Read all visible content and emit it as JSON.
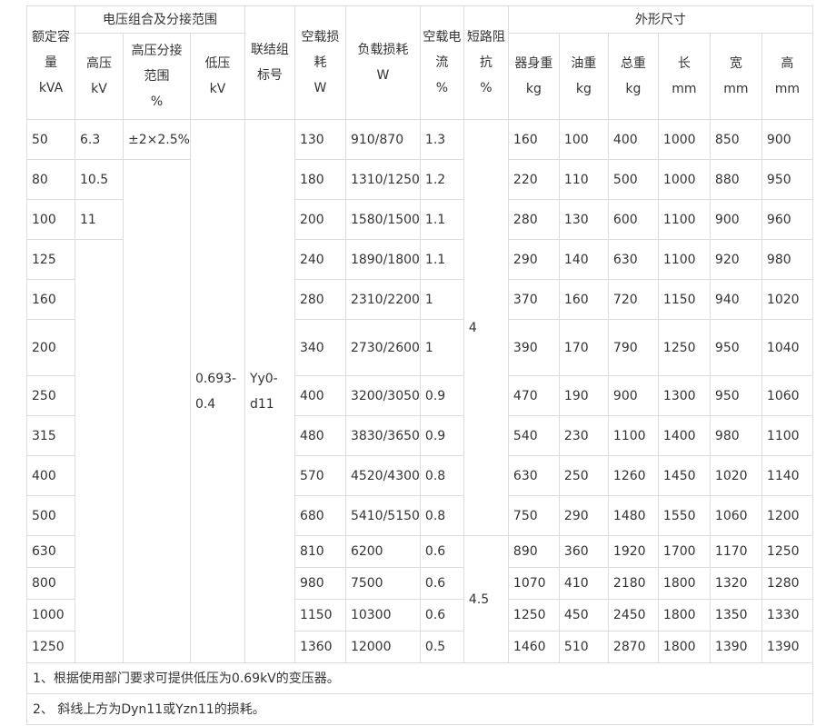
{
  "headers": {
    "capacity": [
      "额定容",
      "量",
      "kVA"
    ],
    "voltage_group": "电压组合及分接范围",
    "hv": [
      "高压",
      "kV"
    ],
    "tap": [
      "高压分接",
      "范围",
      "%"
    ],
    "lv": [
      "低压",
      "kV"
    ],
    "vector": [
      "联结组",
      "标号"
    ],
    "noload_loss": [
      "空载损",
      "耗",
      "W"
    ],
    "load_loss": [
      "负载损耗",
      "W"
    ],
    "noload_current": [
      "空载电",
      "流",
      "%"
    ],
    "impedance": [
      "短路阻",
      "抗",
      "%"
    ],
    "dimensions": "外形尺寸",
    "body_weight": [
      "器身重",
      "kg"
    ],
    "oil_weight": [
      "油重",
      "kg"
    ],
    "total_weight": [
      "总重",
      "kg"
    ],
    "length": [
      "长",
      "mm"
    ],
    "width": [
      "宽",
      "mm"
    ],
    "height": [
      "高",
      "mm"
    ]
  },
  "merged": {
    "hv": [
      "6.3",
      "10.5",
      "11"
    ],
    "tap": "±2×2.5%",
    "lv": [
      "0.693-",
      "0.4"
    ],
    "vector": [
      "Yy0-",
      "d11"
    ],
    "impedance_a": "4",
    "impedance_b": "4.5"
  },
  "rows": [
    {
      "cap": "50",
      "p0": "130",
      "pk": "910/870",
      "i0": "1.3",
      "body": "160",
      "oil": "100",
      "total": "400",
      "len": "1000",
      "wid": "850",
      "hgt": "900"
    },
    {
      "cap": "80",
      "p0": "180",
      "pk": "1310/1250",
      "i0": "1.2",
      "body": "220",
      "oil": "110",
      "total": "500",
      "len": "1000",
      "wid": "880",
      "hgt": "950"
    },
    {
      "cap": "100",
      "p0": "200",
      "pk": "1580/1500",
      "i0": "1.1",
      "body": "280",
      "oil": "130",
      "total": "600",
      "len": "1100",
      "wid": "900",
      "hgt": "960"
    },
    {
      "cap": "125",
      "p0": "240",
      "pk": "1890/1800",
      "i0": "1.1",
      "body": "290",
      "oil": "140",
      "total": "630",
      "len": "1100",
      "wid": "920",
      "hgt": "980"
    },
    {
      "cap": "160",
      "p0": "280",
      "pk": "2310/2200",
      "i0": "1",
      "body": "370",
      "oil": "160",
      "total": "720",
      "len": "1150",
      "wid": "940",
      "hgt": "1020"
    },
    {
      "cap": "200",
      "p0": "340",
      "pk": "2730/2600",
      "i0": "1",
      "body": "390",
      "oil": "170",
      "total": "790",
      "len": "1250",
      "wid": "950",
      "hgt": "1040"
    },
    {
      "cap": "250",
      "p0": "400",
      "pk": "3200/3050",
      "i0": "0.9",
      "body": "470",
      "oil": "190",
      "total": "900",
      "len": "1300",
      "wid": "950",
      "hgt": "1060"
    },
    {
      "cap": "315",
      "p0": "480",
      "pk": "3830/3650",
      "i0": "0.9",
      "body": "540",
      "oil": "230",
      "total": "1100",
      "len": "1400",
      "wid": "980",
      "hgt": "1100"
    },
    {
      "cap": "400",
      "p0": "570",
      "pk": "4520/4300",
      "i0": "0.8",
      "body": "630",
      "oil": "250",
      "total": "1260",
      "len": "1450",
      "wid": "1020",
      "hgt": "1140"
    },
    {
      "cap": "500",
      "p0": "680",
      "pk": "5410/5150",
      "i0": "0.8",
      "body": "750",
      "oil": "290",
      "total": "1480",
      "len": "1550",
      "wid": "1060",
      "hgt": "1200"
    },
    {
      "cap": "630",
      "p0": "810",
      "pk": "6200",
      "i0": "0.6",
      "body": "890",
      "oil": "360",
      "total": "1920",
      "len": "1700",
      "wid": "1170",
      "hgt": "1250"
    },
    {
      "cap": "800",
      "p0": "980",
      "pk": "7500",
      "i0": "0.6",
      "body": "1070",
      "oil": "410",
      "total": "2180",
      "len": "1800",
      "wid": "1320",
      "hgt": "1280"
    },
    {
      "cap": "1000",
      "p0": "1150",
      "pk": "10300",
      "i0": "0.6",
      "body": "1250",
      "oil": "450",
      "total": "2450",
      "len": "1800",
      "wid": "1350",
      "hgt": "1330"
    },
    {
      "cap": "1250",
      "p0": "1360",
      "pk": "12000",
      "i0": "0.5",
      "body": "1460",
      "oil": "510",
      "total": "2870",
      "len": "1800",
      "wid": "1390",
      "hgt": "1390"
    }
  ],
  "notes": [
    "1、根据使用部门要求可提供低压为0.69kV的变压器。",
    "2、  斜线上方为Dyn11或Yzn11的损耗。"
  ]
}
